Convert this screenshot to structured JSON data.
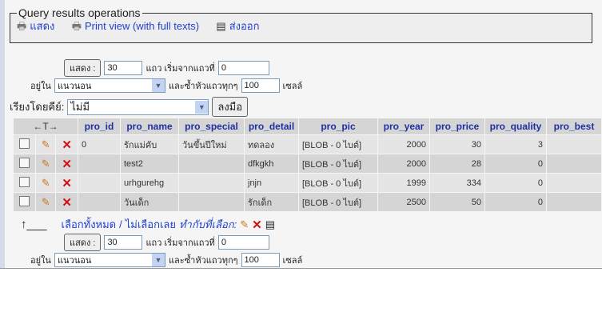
{
  "operations": {
    "legend": "Query results operations",
    "items": [
      {
        "label": "แสดง",
        "icon": "printer-icon"
      },
      {
        "label": "Print view (with full texts)",
        "icon": "printer-icon"
      },
      {
        "label": "ส่งออก",
        "icon": "export-icon"
      }
    ]
  },
  "nav_top": {
    "show_button": "แสดง :",
    "rows": "30",
    "rows_label": "แถว เริ่มจากแถวที่",
    "start": "0",
    "in_label": "อยู่ใน",
    "mode": "แนวนอน",
    "repeat_label": "และซ้ำหัวแถวทุกๆ",
    "repeat": "100",
    "cells_label": "เซลล์"
  },
  "sort": {
    "label": "เรียงโดยคีย์:",
    "value": "ไม่มี",
    "go": "ลงมือ"
  },
  "table": {
    "arrows": "←T→",
    "columns": [
      "pro_id",
      "pro_name",
      "pro_special",
      "pro_detail",
      "pro_pic",
      "pro_year",
      "pro_price",
      "pro_quality",
      "pro_best"
    ],
    "rows": [
      [
        "0",
        "รักแม่คับ",
        "วันขึ้นปีใหม่",
        "ทดลอง",
        "[BLOB - 0 ไบต์]",
        "2000",
        "30",
        "3",
        ""
      ],
      [
        "",
        "test2",
        "",
        "dfkgkh",
        "[BLOB - 0 ไบต์]",
        "2000",
        "28",
        "0",
        ""
      ],
      [
        "",
        "urhgurehg",
        "",
        "jnjn",
        "[BLOB - 0 ไบต์]",
        "1999",
        "334",
        "0",
        ""
      ],
      [
        "",
        "วันเด็ก",
        "",
        "รักเด็ก",
        "[BLOB - 0 ไบต์]",
        "2500",
        "50",
        "0",
        ""
      ]
    ]
  },
  "footer": {
    "check_all": "เลือกทั้งหมด",
    "sep": "/",
    "uncheck_all": "ไม่เลือกเลย",
    "with_selected": "ทำกับที่เลือก:"
  },
  "nav_bottom": {
    "show_button": "แสดง :",
    "rows": "30",
    "rows_label": "แถว เริ่มจากแถวที่",
    "start": "0",
    "in_label": "อยู่ใน",
    "mode": "แนวนอน",
    "repeat_label": "และซ้ำหัวแถวทุกๆ",
    "repeat": "100",
    "cells_label": "เซลล์"
  }
}
